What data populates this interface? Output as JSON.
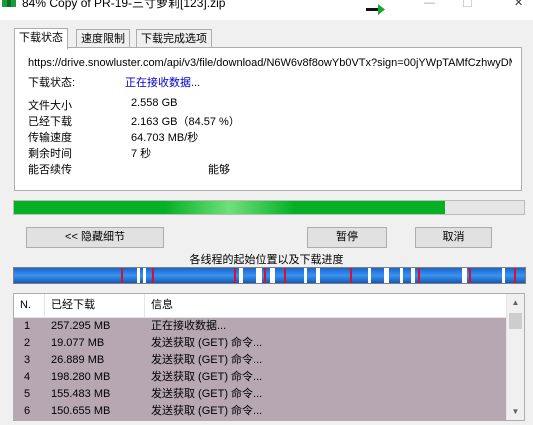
{
  "window": {
    "title": "84% Copy of PR-19-三寸萝莉[123].zip",
    "min_glyph": "—",
    "max_glyph": "☐",
    "close_glyph": "✕"
  },
  "tabs": [
    {
      "label": "下载状态",
      "active": true
    },
    {
      "label": "速度限制",
      "active": false
    },
    {
      "label": "下载完成选项",
      "active": false
    }
  ],
  "status": {
    "url": "https://drive.snowluster.com/api/v3/file/download/N6W6v8f8owYb0VTx?sign=00jYWpTAMfCzhwyDM",
    "state_label": "下载状态:",
    "state_value": "正在接收数据...",
    "fields": [
      {
        "label": "文件大小",
        "value": "2.558 GB"
      },
      {
        "label": "已经下载",
        "value": "2.163 GB（84.57 %）"
      },
      {
        "label": "传输速度",
        "value": "64.703 MB/秒"
      },
      {
        "label": "剩余时间",
        "value": "7 秒"
      },
      {
        "label": "能否续传",
        "value": "能够"
      }
    ]
  },
  "progress": {
    "percent": 84.57
  },
  "buttons": {
    "hide_details": "<< 隐藏细节",
    "pause": "暂停",
    "cancel": "取消"
  },
  "threads_label": "各线程的起始位置以及下载进度",
  "table": {
    "columns": [
      "N.",
      "已经下载",
      "信息"
    ],
    "rows": [
      {
        "n": "1",
        "downloaded": "257.295 MB",
        "info": "正在接收数据..."
      },
      {
        "n": "2",
        "downloaded": "19.077 MB",
        "info": "发送获取 (GET) 命令..."
      },
      {
        "n": "3",
        "downloaded": "26.889 MB",
        "info": "发送获取 (GET) 命令..."
      },
      {
        "n": "4",
        "downloaded": "198.280 MB",
        "info": "发送获取 (GET) 命令..."
      },
      {
        "n": "5",
        "downloaded": "155.483 MB",
        "info": "发送获取 (GET) 命令..."
      },
      {
        "n": "6",
        "downloaded": "150.655 MB",
        "info": "发送获取 (GET) 命令..."
      }
    ]
  },
  "colors": {
    "progress_green": "#06b025",
    "link_blue": "#0000cc",
    "row_highlight": "#b7a7b3",
    "segment_blue": "#2a7ee0",
    "segment_red": "#d8102a"
  },
  "icons": {
    "app": "archive-icon",
    "arrow": "green-arrow-icon"
  }
}
